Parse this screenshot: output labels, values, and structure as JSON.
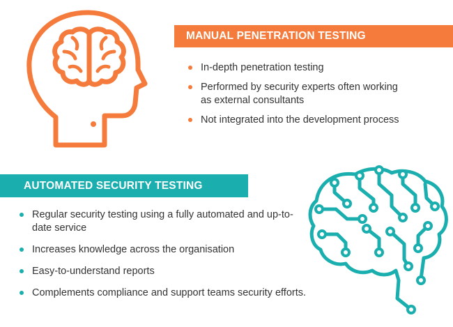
{
  "colors": {
    "orange": "#f47b3b",
    "teal": "#1aaeae",
    "text": "#333333"
  },
  "icons": {
    "head": "human-head-with-brain-icon",
    "circuit": "circuit-brain-icon"
  },
  "manual": {
    "title": "MANUAL PENETRATION TESTING",
    "items": [
      "In-depth penetration testing",
      "Performed by security experts often working as external consultants",
      "Not integrated into the development process"
    ]
  },
  "automated": {
    "title": "AUTOMATED SECURITY TESTING",
    "items": [
      "Regular security testing using a fully automated and up-to-date service",
      "Increases knowledge across the organisation",
      "Easy-to-understand reports",
      "Complements compliance and support teams  security efforts."
    ]
  }
}
